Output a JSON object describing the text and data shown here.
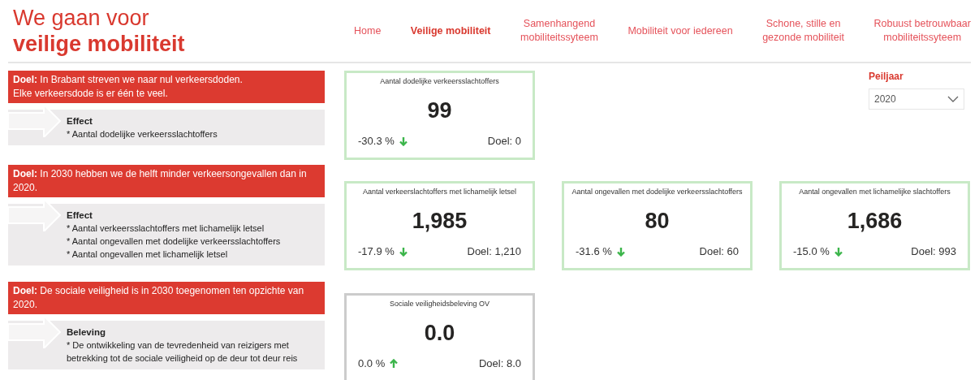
{
  "title": {
    "line_1": "We gaan voor",
    "line_2": "veilige mobiliteit"
  },
  "nav": [
    {
      "label": "Home",
      "selected": false
    },
    {
      "label": "Veilige mobiliteit",
      "selected": true
    },
    {
      "label": "Samenhangend\nmobiliteitssyteem",
      "selected": false
    },
    {
      "label": "Mobiliteit voor iedereen",
      "selected": false
    },
    {
      "label": "Schone, stille en\ngezonde mobiliteit",
      "selected": false
    },
    {
      "label": "Robuust betrouwbaar\nmobiliteitssyteem",
      "selected": false
    }
  ],
  "filter": {
    "label": "Peiljaar",
    "value": "2020"
  },
  "sections": [
    {
      "goal": "**Doel:** In Brabant streven we naar nul verkeersdoden.\nElke verkeersdode is er één te veel.",
      "heading": "Effect",
      "items": [
        "* Aantal dodelijke verkeersslachtoffers"
      ],
      "cards": [
        {
          "title": "Aantal dodelijke verkeersslachtoffers",
          "value": "99",
          "change": "-30.3 %",
          "rising": false,
          "target": "Doel: 0",
          "color": "#c8e9c6"
        }
      ]
    },
    {
      "goal": "**Doel:** In 2030 hebben we de helft minder verkeersongevallen dan in 2020.",
      "heading": "Effect",
      "items": [
        "* Aantal verkeersslachtoffers met lichamelijk letsel",
        "* Aantal ongevallen met dodelijke verkeersslachtoffers",
        "* Aantal ongevallen met lichamelijk letsel"
      ],
      "cards": [
        {
          "title": "Aantal verkeerslachtoffers met lichamelijk letsel",
          "value": "1,985",
          "change": "-17.9 %",
          "rising": false,
          "target": "Doel: 1,210",
          "color": "#c8e9c6"
        },
        {
          "title": "Aantal ongevallen met dodelijke verkeersslachtoffers",
          "value": "80",
          "change": "-31.6 %",
          "rising": false,
          "target": "Doel: 60",
          "color": "#c8e9c6"
        },
        {
          "title": "Aantal ongevallen met lichamelijke slachtoffers",
          "value": "1,686",
          "change": "-15.0 %",
          "rising": false,
          "target": "Doel: 993",
          "color": "#c8e9c6"
        }
      ]
    },
    {
      "goal": "**Doel:** De sociale veiligheid is in 2030 toegenomen ten opzichte van 2020.",
      "heading": "Beleving",
      "items": [
        "* De ontwikkeling van de tevredenheid van reizigers met betrekking tot de sociale veiligheid op de deur tot deur reis"
      ],
      "cards": [
        {
          "title": "Sociale veiligheidsbeleving OV",
          "value": "0.0",
          "change": "0.0 %",
          "rising": true,
          "target": "Doel: 8.0",
          "color": "#cccccc"
        }
      ]
    }
  ]
}
